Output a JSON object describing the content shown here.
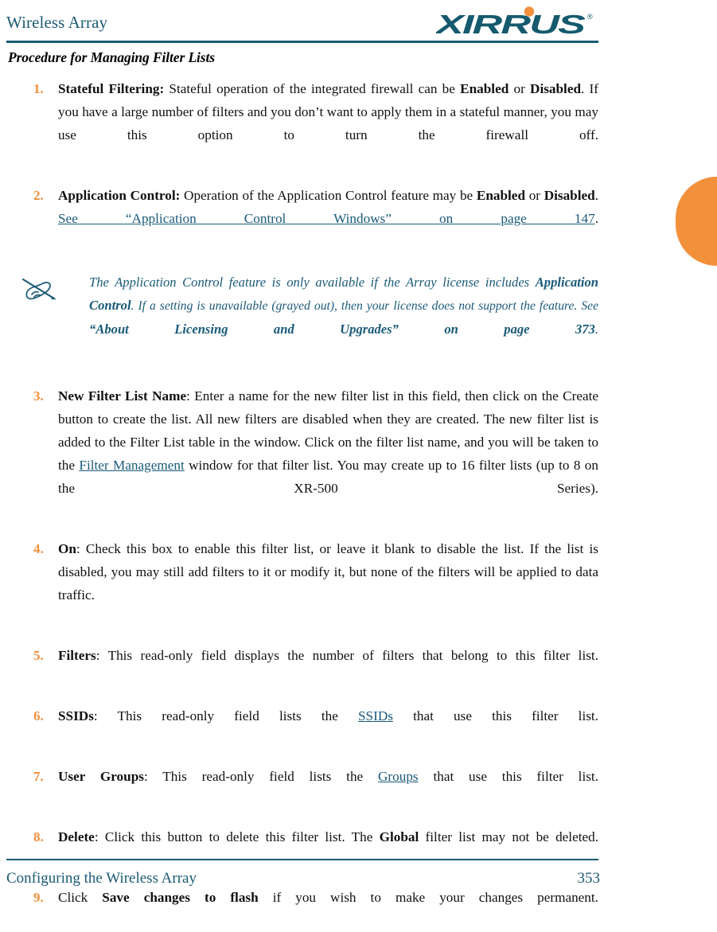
{
  "header": {
    "title": "Wireless Array",
    "logo_text": "XIRRUS",
    "logo_trademark": "®"
  },
  "section": {
    "heading": "Procedure for Managing Filter Lists"
  },
  "colors": {
    "teal": "#1a5a73",
    "link_teal": "#1a5a7a",
    "orange": "#F2903C",
    "body_text": "#111111"
  },
  "steps": [
    {
      "num": "1.",
      "label": "Stateful Filtering:",
      "parts": [
        {
          "text": "Stateful Filtering:",
          "style": "bold"
        },
        {
          "text": " Stateful operation of the integrated firewall can be ",
          "style": "normal"
        },
        {
          "text": "Enabled",
          "style": "bold"
        },
        {
          "text": " or ",
          "style": "normal"
        },
        {
          "text": "Disabled",
          "style": "bold"
        },
        {
          "text": ". If you have a large number of filters and you don’t want to apply them in a stateful manner, you may use this option to turn the firewall off.",
          "style": "normal"
        }
      ]
    },
    {
      "num": "2.",
      "label": "Application Control:",
      "parts": [
        {
          "text": "Application Control:",
          "style": "bold"
        },
        {
          "text": " Operation of the Application Control feature may be ",
          "style": "normal"
        },
        {
          "text": "Enabled",
          "style": "bold"
        },
        {
          "text": " or ",
          "style": "normal"
        },
        {
          "text": "Disabled",
          "style": "bold"
        },
        {
          "text": ". ",
          "style": "normal"
        },
        {
          "text": "See “Application Control Windows” on page 147",
          "style": "xref"
        },
        {
          "text": ".",
          "style": "normal"
        }
      ]
    },
    {
      "num": "3.",
      "label": "New Filter List Name:",
      "parts": [
        {
          "text": "New Filter List Name",
          "style": "bold"
        },
        {
          "text": ": Enter a name for the new filter list in this field, then click on the Create button to create the list. All new filters are disabled when they are created. The new filter list is added to the Filter List table in the window. Click on the filter list name, and you will be taken to the ",
          "style": "normal"
        },
        {
          "text": "Filter Management",
          "style": "xref"
        },
        {
          "text": " window for that filter list. You may create up to 16 filter lists (up to 8 on the XR-500 Series).",
          "style": "normal"
        }
      ]
    },
    {
      "num": "4.",
      "label": "On:",
      "parts": [
        {
          "text": "On",
          "style": "bold"
        },
        {
          "text": ": Check this box to enable this filter list, or leave it blank to disable the list. If the list is disabled, you may still add filters to it or modify it, but none of the filters will be applied to data traffic.",
          "style": "normal"
        }
      ]
    },
    {
      "num": "5.",
      "label": "Filters:",
      "parts": [
        {
          "text": "Filters",
          "style": "bold"
        },
        {
          "text": ": This read-only field displays the number of filters that belong to this filter list.",
          "style": "normal"
        }
      ]
    },
    {
      "num": "6.",
      "label": "SSIDs:",
      "parts": [
        {
          "text": "SSIDs",
          "style": "bold"
        },
        {
          "text": ": This read-only field lists the ",
          "style": "normal"
        },
        {
          "text": "SSIDs",
          "style": "xref"
        },
        {
          "text": " that use this filter list.",
          "style": "normal"
        }
      ]
    },
    {
      "num": "7.",
      "label": "User Groups:",
      "parts": [
        {
          "text": "User Groups",
          "style": "bold"
        },
        {
          "text": ": This read-only field lists the ",
          "style": "normal"
        },
        {
          "text": "Groups",
          "style": "xref"
        },
        {
          "text": " that use this filter list.",
          "style": "normal"
        }
      ]
    },
    {
      "num": "8.",
      "label": "Delete:",
      "parts": [
        {
          "text": "Delete",
          "style": "bold"
        },
        {
          "text": ": Click this button to delete this filter list. The ",
          "style": "normal"
        },
        {
          "text": "Global",
          "style": "bold"
        },
        {
          "text": " filter list may not be deleted.",
          "style": "normal"
        }
      ]
    },
    {
      "num": "9.",
      "label": "Save changes to flash",
      "parts": [
        {
          "text": "Click ",
          "style": "normal"
        },
        {
          "text": "Save changes to flash",
          "style": "bold"
        },
        {
          "text": " if you wish to make your changes permanent.",
          "style": "normal"
        }
      ]
    }
  ],
  "note": {
    "icon_name": "note-pencil-icon",
    "parts": [
      {
        "text": "The Application Control feature is only available if the Array license includes ",
        "style": "normal"
      },
      {
        "text": "Application Control",
        "style": "bold"
      },
      {
        "text": ". If a setting is unavailable (grayed out), then your license does not support the feature. See ",
        "style": "small"
      },
      {
        "text": "“About Licensing and Upgrades” on page 373",
        "style": "bold"
      },
      {
        "text": ".",
        "style": "normal"
      }
    ]
  },
  "footer": {
    "left": "Configuring the Wireless Array",
    "page_number": "353"
  }
}
